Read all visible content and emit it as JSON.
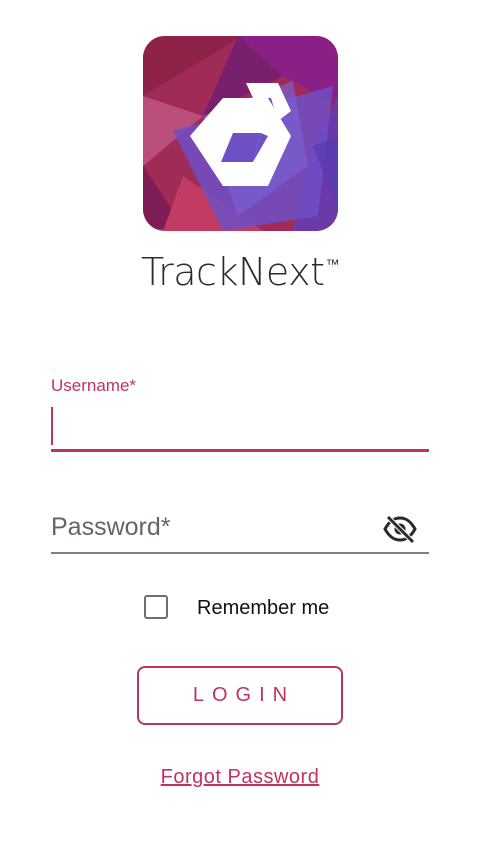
{
  "app": {
    "name": "TrackNext",
    "trademark": "™",
    "logo_icon": "tracknext-logo-icon"
  },
  "form": {
    "username": {
      "label": "Username*",
      "value": ""
    },
    "password": {
      "placeholder": "Password*",
      "value": "",
      "toggle_icon": "eye-off-icon"
    },
    "remember": {
      "label": "Remember me",
      "checked": false
    },
    "login_label": "LOGIN",
    "forgot_label": "Forgot Password"
  },
  "colors": {
    "accent": "#c0335f",
    "text": "#2b2b2b",
    "muted": "#5f6670"
  }
}
